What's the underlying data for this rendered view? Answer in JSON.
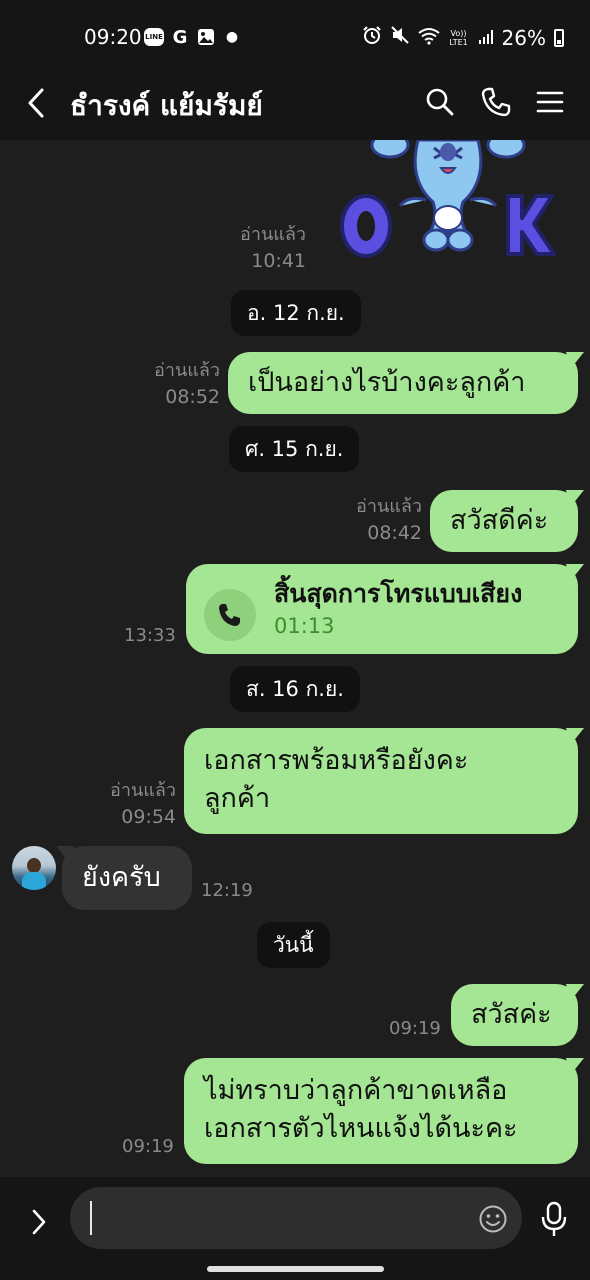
{
  "status_bar": {
    "time": "09:20",
    "battery": "26%",
    "left_icons": [
      "line-app-icon",
      "google-icon",
      "gallery-icon",
      "dot-indicator"
    ],
    "right_icons": [
      "alarm-icon",
      "mute-icon",
      "wifi-icon",
      "volte-icon",
      "signal-icon",
      "battery-icon"
    ],
    "volte_label": "Vo)) LTE1"
  },
  "header": {
    "title": "ธำรงค์ แย้มรัมย์",
    "back_icon": "chevron-left-icon",
    "actions": [
      "search-icon",
      "phone-icon",
      "menu-icon"
    ]
  },
  "chat": {
    "sticker": {
      "read_label": "อ่านแล้ว",
      "time": "10:41",
      "letters": "OK"
    },
    "dates": {
      "d1": "อ. 12 ก.ย.",
      "d2": "ศ. 15 ก.ย.",
      "d3": "ส. 16 ก.ย.",
      "d4": "วันนี้"
    },
    "messages": [
      {
        "direction": "out",
        "text": "เป็นอย่างไรบ้างคะลูกค้า",
        "read": "อ่านแล้ว",
        "time": "08:52"
      },
      {
        "direction": "out",
        "text": "สวัสดีค่ะ",
        "read": "อ่านแล้ว",
        "time": "08:42"
      },
      {
        "direction": "out",
        "type": "call",
        "call_title": "สิ้นสุดการโทรแบบเสียง",
        "call_duration": "01:13",
        "time": "13:33"
      },
      {
        "direction": "out",
        "text_line1": "เอกสารพร้อมหรือยังคะ",
        "text_line2": "ลูกค้า",
        "read": "อ่านแล้ว",
        "time": "09:54"
      },
      {
        "direction": "in",
        "text": "ยังครับ",
        "time": "12:19"
      },
      {
        "direction": "out",
        "text": "สวัสค่ะ",
        "time": "09:19"
      },
      {
        "direction": "out",
        "text_line1": "ไม่ทราบว่าลูกค้าขาดเหลือ",
        "text_line2": "เอกสารตัวไหนแจ้งได้นะคะ",
        "time": "09:19"
      }
    ]
  },
  "composer": {
    "placeholder": "",
    "icons": [
      "chevron-right-icon",
      "emoji-icon",
      "microphone-icon"
    ]
  },
  "colors": {
    "outgoing_bubble": "#a4e693",
    "incoming_bubble": "#333333",
    "background": "#1e1e1e",
    "bar": "#151515"
  }
}
